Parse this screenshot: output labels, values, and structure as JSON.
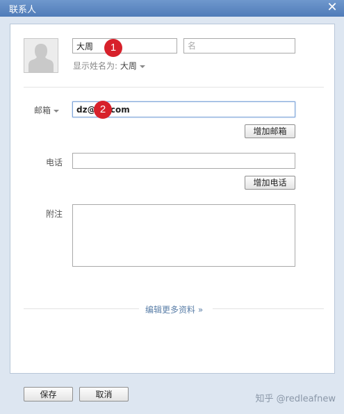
{
  "window": {
    "title": "联系人"
  },
  "profile": {
    "last_name": "大周",
    "first_name_placeholder": "名",
    "display_label": "显示姓名为:",
    "display_value": "大周"
  },
  "email": {
    "label": "邮箱",
    "value": "dz@    .com",
    "add_label": "增加邮箱"
  },
  "phone": {
    "label": "电话",
    "value": "",
    "add_label": "增加电话"
  },
  "note": {
    "label": "附注",
    "value": ""
  },
  "more_link": "编辑更多资料",
  "footer": {
    "save_label": "保存",
    "cancel_label": "取消"
  },
  "annotations": [
    "1",
    "2"
  ],
  "watermark": "知乎 @redleafnew"
}
